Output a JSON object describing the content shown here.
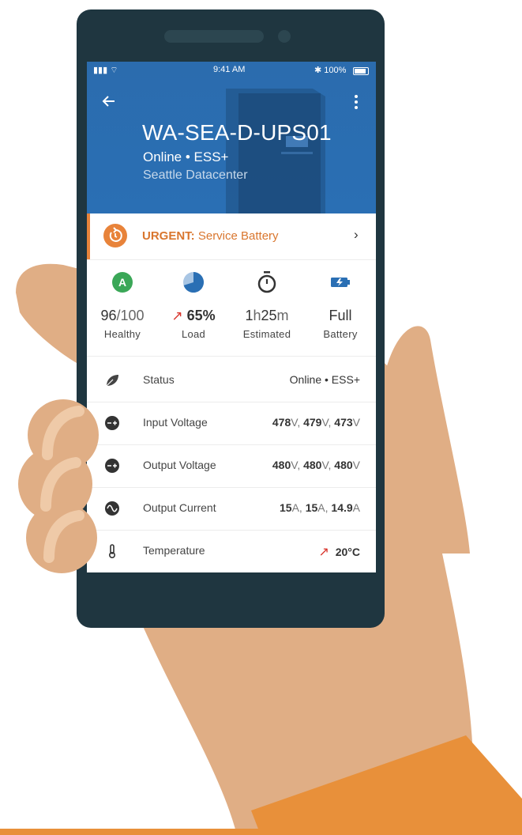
{
  "status_bar": {
    "signal": "▮▮▮ ⌔",
    "time": "9:41 AM",
    "battery": "✱ 100%"
  },
  "header": {
    "device_name": "WA-SEA-D-UPS01",
    "status": "Online • ESS+",
    "location": "Seattle Datacenter"
  },
  "alert": {
    "prefix": "URGENT:",
    "message": "Service Battery"
  },
  "metrics": [
    {
      "icon": "grade-a-icon",
      "value_main": "96",
      "value_sub": "/100",
      "label": "Healthy"
    },
    {
      "icon": "pie-chart-icon",
      "value_main": "65%",
      "label": "Load",
      "trend": "up"
    },
    {
      "icon": "stopwatch-icon",
      "value_h": "1",
      "unit_h": "h",
      "value_m": "25",
      "unit_m": "m",
      "label": "Estimated"
    },
    {
      "icon": "battery-charging-icon",
      "value_main": "Full",
      "label": "Battery"
    }
  ],
  "details": [
    {
      "icon": "leaf-icon",
      "label": "Status",
      "value": "Online • ESS+"
    },
    {
      "icon": "input-voltage-icon",
      "label": "Input Voltage",
      "values": [
        "478",
        "479",
        "473"
      ],
      "unit": "V"
    },
    {
      "icon": "output-voltage-icon",
      "label": "Output Voltage",
      "values": [
        "480",
        "480",
        "480"
      ],
      "unit": "V"
    },
    {
      "icon": "sine-wave-icon",
      "label": "Output Current",
      "values": [
        "15",
        "15",
        "14.9"
      ],
      "unit": "A"
    },
    {
      "icon": "thermometer-icon",
      "label": "Temperature",
      "value": "20°C",
      "trend": "up"
    }
  ],
  "colors": {
    "brand_blue": "#2a6fb4",
    "accent_orange": "#e8833a",
    "phone_body": "#1f3640",
    "skin": "#e0ae85",
    "sleeve": "#e8903a",
    "grade_green": "#3aa757"
  }
}
